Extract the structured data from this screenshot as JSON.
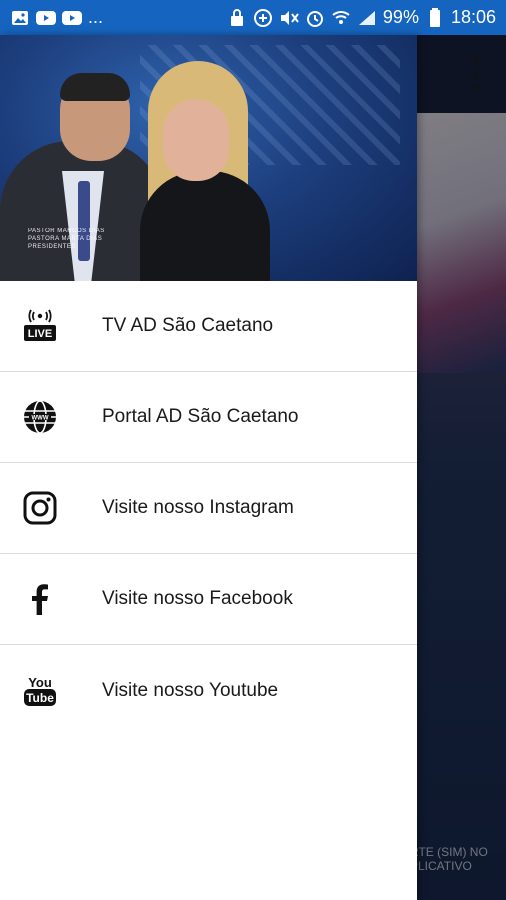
{
  "status_bar": {
    "left_icons": [
      "image-icon",
      "youtube-icon",
      "youtube-icon"
    ],
    "ellipsis": "...",
    "battery": "99%",
    "time": "18:06"
  },
  "header": {
    "caption_lines": [
      "PASTOR MARCOS DIAS",
      "PASTORA MARTA DIAS",
      "PRESIDENTES"
    ]
  },
  "menu": {
    "items": [
      {
        "label": "TV AD São Caetano",
        "icon": "live-icon"
      },
      {
        "label": "Portal AD São Caetano",
        "icon": "globe-icon"
      },
      {
        "label": "Visite nosso Instagram",
        "icon": "instagram-icon"
      },
      {
        "label": "Visite nosso Facebook",
        "icon": "facebook-icon"
      },
      {
        "label": "Visite nosso Youtube",
        "icon": "youtube-icon"
      }
    ]
  },
  "background": {
    "caption": "RTE (SIM) NO\nPLICATIVO"
  },
  "colors": {
    "status_bar": "#1565c0",
    "drawer_bg": "#ffffff",
    "text": "#1a1a1a"
  }
}
